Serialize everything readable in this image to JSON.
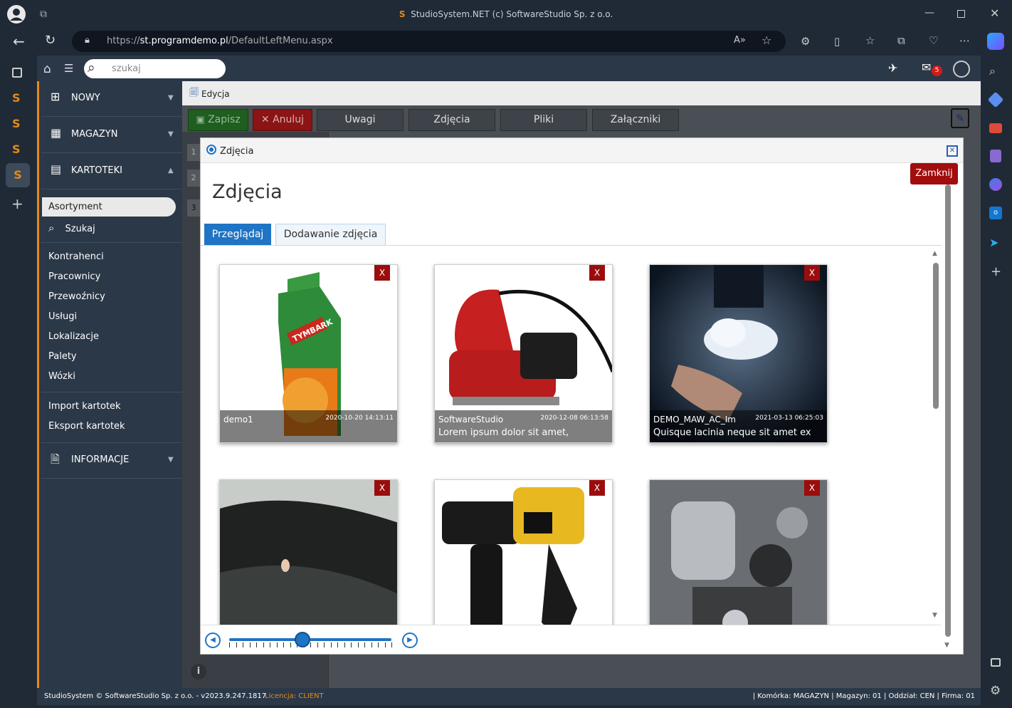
{
  "browser": {
    "title": "StudioSystem.NET (c) SoftwareStudio Sp. z o.o.",
    "url_prefix": "https://",
    "url_host": "st.programdemo.pl",
    "url_path": "/DefaultLeftMenu.aspx"
  },
  "app": {
    "search_placeholder": "szukaj",
    "mail_badge": "5"
  },
  "sidebar": {
    "sections": [
      {
        "label": "NOWY"
      },
      {
        "label": "MAGAZYN"
      },
      {
        "label": "KARTOTEKI"
      }
    ],
    "active_item": "Asortyment",
    "search_item": "Szukaj",
    "group1": [
      "Kontrahenci",
      "Pracownicy",
      "Przewoźnicy",
      "Usługi",
      "Lokalizacje",
      "Palety",
      "Wózki"
    ],
    "group2": [
      "Import kartotek",
      "Eksport kartotek"
    ],
    "info_section": "INFORMACJE"
  },
  "page": {
    "edit_tab": "Edycja",
    "toolbar": {
      "save": "Zapisz",
      "cancel": "Anuluj",
      "notes": "Uwagi",
      "photos": "Zdjęcia",
      "files": "Pliki",
      "attachments": "Załączniki"
    }
  },
  "modal": {
    "header": "Zdjęcia",
    "title": "Zdjęcia",
    "close_label": "Zamknij",
    "tabs": [
      "Przeglądaj",
      "Dodawanie zdjęcia"
    ],
    "slider_value": 0.45,
    "cards": [
      {
        "name": "demo1",
        "date": "2020-10-20 14:13:11",
        "desc": ""
      },
      {
        "name": "SoftwareStudio",
        "date": "2020-12-08 06:13:58",
        "desc": "Lorem ipsum dolor sit amet,"
      },
      {
        "name": "DEMO_MAW_AC_Im",
        "date": "2021-03-13 06:25:03",
        "desc": "Quisque lacinia neque sit amet ex"
      },
      {
        "name": "",
        "date": "",
        "desc": ""
      },
      {
        "name": "",
        "date": "",
        "desc": ""
      },
      {
        "name": "",
        "date": "",
        "desc": ""
      }
    ],
    "delete_label": "X"
  },
  "footer": {
    "copyright": "StudioSystem © SoftwareStudio Sp. z o.o. - v2023.9.247.1817",
    "license": "Licencja: CLIENT",
    "status": "| Komórka: MAGAZYN | Magazyn: 01 | Oddział: CEN | Firma: 01"
  },
  "colors": {
    "accent_orange": "#e58a19",
    "sidebar_bg": "#2b3848",
    "save_green": "#1e5e1e",
    "cancel_red": "#8b1414",
    "tab_blue": "#1f74c4",
    "delete_red": "#9b0d0d"
  }
}
